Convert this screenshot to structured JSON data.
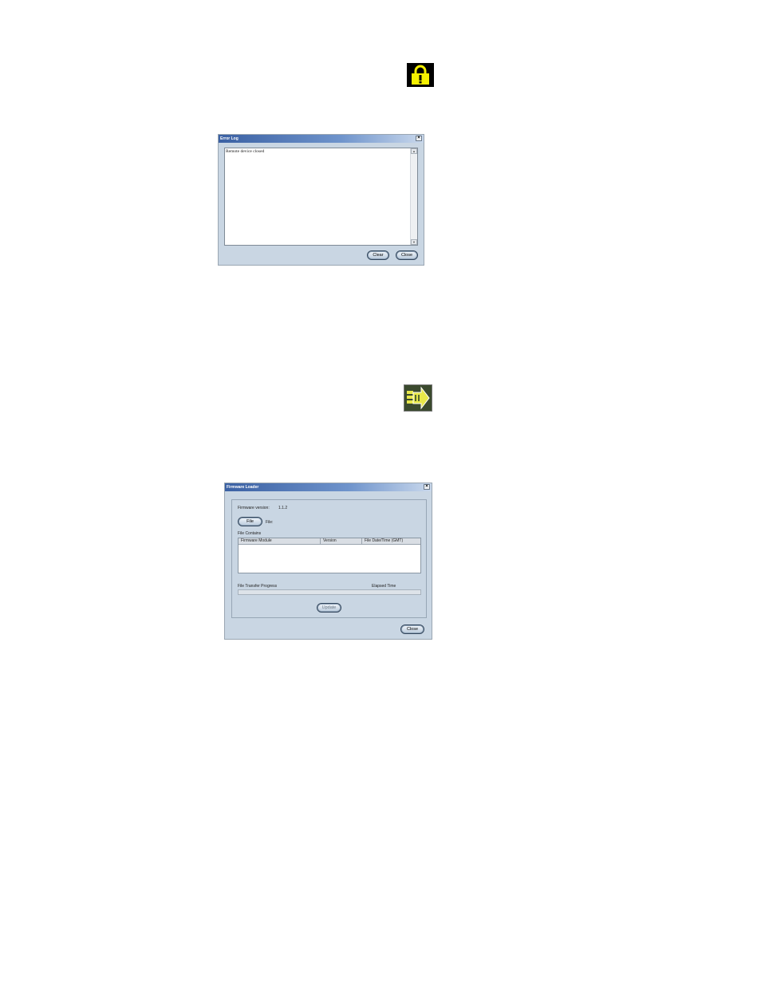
{
  "icons": {
    "lock": "lock-icon",
    "arrow": "firmware-arrow-icon",
    "colors": {
      "lock_yellow": "#f5f000",
      "arrow_yellow": "#e8e84a"
    }
  },
  "error_log": {
    "title": "Error Log",
    "close_x": "×",
    "message": "Remote device closed",
    "buttons": {
      "clear": "Clear",
      "close": "Close"
    }
  },
  "firmware_loader": {
    "title": "Firmware Loader",
    "close_x": "×",
    "firmware_version_label": "Firmware version:",
    "firmware_version_value": "1.1.2",
    "file_button": "File",
    "file_label": "File:",
    "file_contains_label": "File Contains",
    "columns": [
      "Firmware Module",
      "Version",
      "File Date/Time (GMT)"
    ],
    "progress_label": "File Transfer Progress",
    "elapsed_label": "Elapsed Time",
    "progress": 0,
    "update_button": "Update",
    "close_button": "Close"
  }
}
